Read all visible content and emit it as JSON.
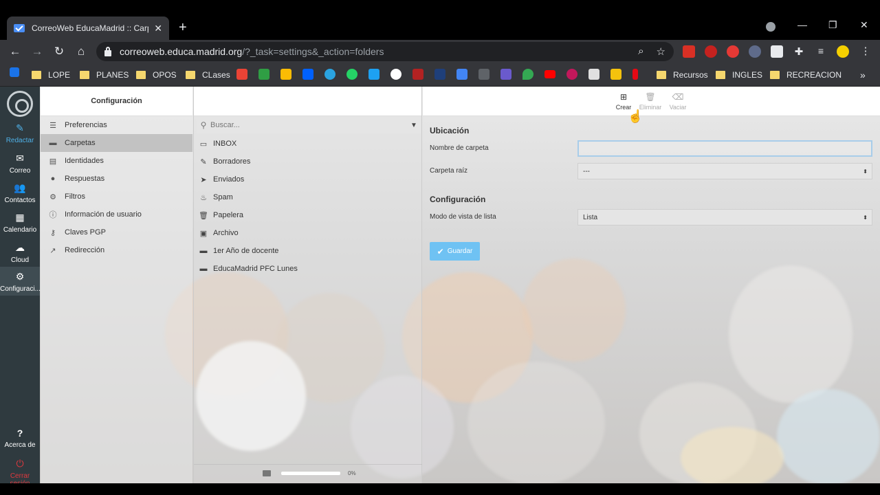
{
  "browser": {
    "tab_title": "CorreoWeb EducaMadrid :: Carpe",
    "url_host": "correoweb.educa.madrid.org",
    "url_path": "/?_task=settings&_action=folders",
    "bookmarks": [
      "LOPE",
      "PLANES",
      "OPOS",
      "CLases",
      "Recursos",
      "INGLES",
      "RECREACION"
    ]
  },
  "rail": {
    "items": [
      {
        "label": "Redactar",
        "icon": "pencil-icon"
      },
      {
        "label": "Correo",
        "icon": "envelope-icon"
      },
      {
        "label": "Contactos",
        "icon": "users-icon"
      },
      {
        "label": "Calendario",
        "icon": "calendar-icon"
      },
      {
        "label": "Cloud",
        "icon": "cloud-icon"
      },
      {
        "label": "Configuraci...",
        "icon": "gear-icon"
      }
    ],
    "about": "Acerca de",
    "logout": "Cerrar sesión"
  },
  "settings": {
    "title": "Configuración",
    "items": [
      {
        "label": "Preferencias",
        "icon": "sliders-icon"
      },
      {
        "label": "Carpetas",
        "icon": "folder-icon"
      },
      {
        "label": "Identidades",
        "icon": "id-card-icon"
      },
      {
        "label": "Respuestas",
        "icon": "comment-icon"
      },
      {
        "label": "Filtros",
        "icon": "gear-icon"
      },
      {
        "label": "Información de usuario",
        "icon": "info-icon"
      },
      {
        "label": "Claves PGP",
        "icon": "key-icon"
      },
      {
        "label": "Redirección",
        "icon": "external-link-icon"
      }
    ]
  },
  "folders": {
    "search_placeholder": "Buscar...",
    "items": [
      {
        "label": "INBOX",
        "icon": "inbox-icon"
      },
      {
        "label": "Borradores",
        "icon": "pencil-icon"
      },
      {
        "label": "Enviados",
        "icon": "send-icon"
      },
      {
        "label": "Spam",
        "icon": "fire-icon"
      },
      {
        "label": "Papelera",
        "icon": "trash-icon"
      },
      {
        "label": "Archivo",
        "icon": "archive-icon"
      },
      {
        "label": "1er Año de docente",
        "icon": "folder-icon"
      },
      {
        "label": "EducaMadrid PFC Lunes",
        "icon": "folder-icon"
      }
    ],
    "quota_text": "0%",
    "quota_percent": 0
  },
  "toolbar": {
    "create": "Crear",
    "delete": "Eliminar",
    "empty": "Vaciar"
  },
  "form": {
    "location_heading": "Ubicación",
    "folder_name_label": "Nombre de carpeta",
    "folder_name_value": "",
    "parent_label": "Carpeta raíz",
    "parent_value": "---",
    "config_heading": "Configuración",
    "view_mode_label": "Modo de vista de lista",
    "view_mode_value": "Lista",
    "save_label": "Guardar"
  },
  "colors": {
    "accent": "#4fb1e8",
    "save_button": "#6fc2f3",
    "rail_bg": "#2f3a3f",
    "logout": "#e0383e"
  }
}
